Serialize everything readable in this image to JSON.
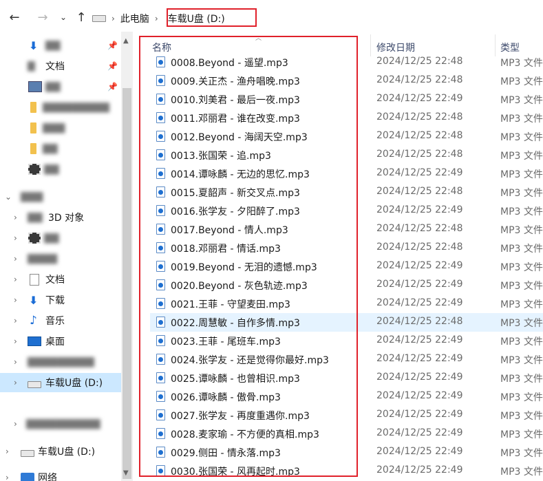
{
  "address": {
    "root_label": "此电脑",
    "current_label": "车载U盘 (D:)"
  },
  "nav_pane": {
    "items": [
      {
        "label": "",
        "icon": "download-icon",
        "pinned": true,
        "blurred": true
      },
      {
        "label": "文档",
        "icon": "document-icon",
        "pinned": true,
        "blurred": true
      },
      {
        "label": "",
        "icon": "picture-icon",
        "pinned": true,
        "blurred": true
      },
      {
        "label": "",
        "icon": "folder-icon",
        "blurred": true
      },
      {
        "label": "",
        "icon": "folder-icon",
        "blurred": true
      },
      {
        "label": "",
        "icon": "folder-icon",
        "blurred": true
      },
      {
        "label": "",
        "icon": "video-icon",
        "blurred": true
      },
      {
        "label": "",
        "icon": "pc-icon",
        "blurred": true
      },
      {
        "label": "3D 对象",
        "icon": "3d-object-icon",
        "blurred": true
      },
      {
        "label": "",
        "icon": "video-icon",
        "blurred": true
      },
      {
        "label": "",
        "icon": "picture-icon",
        "blurred": true
      },
      {
        "label": "文档",
        "icon": "document-icon"
      },
      {
        "label": "下载",
        "icon": "download-icon"
      },
      {
        "label": "音乐",
        "icon": "music-icon"
      },
      {
        "label": "桌面",
        "icon": "desktop-icon"
      },
      {
        "label": "",
        "icon": "drive-icon",
        "blurred": true
      },
      {
        "label": "车载U盘 (D:)",
        "icon": "usb-drive-icon",
        "selected": true
      },
      {
        "label": "",
        "icon": "drive-icon",
        "blurred": true
      },
      {
        "label": "车载U盘 (D:)",
        "icon": "usb-drive-icon"
      },
      {
        "label": "网络",
        "icon": "network-icon"
      }
    ]
  },
  "file_list": {
    "columns": {
      "name": "名称",
      "date": "修改日期",
      "type": "类型"
    },
    "rows": [
      {
        "name": "0008.Beyond - 遥望.mp3",
        "date": "2024/12/25 22:48",
        "type": "MP3 文件"
      },
      {
        "name": "0009.关正杰 - 渔舟唱晚.mp3",
        "date": "2024/12/25 22:48",
        "type": "MP3 文件"
      },
      {
        "name": "0010.刘美君 - 最后一夜.mp3",
        "date": "2024/12/25 22:49",
        "type": "MP3 文件"
      },
      {
        "name": "0011.邓丽君 - 谁在改变.mp3",
        "date": "2024/12/25 22:48",
        "type": "MP3 文件"
      },
      {
        "name": "0012.Beyond - 海阔天空.mp3",
        "date": "2024/12/25 22:48",
        "type": "MP3 文件"
      },
      {
        "name": "0013.张国荣 - 追.mp3",
        "date": "2024/12/25 22:48",
        "type": "MP3 文件"
      },
      {
        "name": "0014.谭咏麟 - 无边的思忆.mp3",
        "date": "2024/12/25 22:49",
        "type": "MP3 文件"
      },
      {
        "name": "0015.夏韶声 - 新交叉点.mp3",
        "date": "2024/12/25 22:48",
        "type": "MP3 文件"
      },
      {
        "name": "0016.张学友 - 夕阳醉了.mp3",
        "date": "2024/12/25 22:49",
        "type": "MP3 文件"
      },
      {
        "name": "0017.Beyond - 情人.mp3",
        "date": "2024/12/25 22:48",
        "type": "MP3 文件"
      },
      {
        "name": "0018.邓丽君 - 情话.mp3",
        "date": "2024/12/25 22:48",
        "type": "MP3 文件"
      },
      {
        "name": "0019.Beyond - 无泪的遗憾.mp3",
        "date": "2024/12/25 22:49",
        "type": "MP3 文件"
      },
      {
        "name": "0020.Beyond - 灰色轨迹.mp3",
        "date": "2024/12/25 22:49",
        "type": "MP3 文件"
      },
      {
        "name": "0021.王菲 - 守望麦田.mp3",
        "date": "2024/12/25 22:49",
        "type": "MP3 文件"
      },
      {
        "name": "0022.周慧敏 - 自作多情.mp3",
        "date": "2024/12/25 22:48",
        "type": "MP3 文件"
      },
      {
        "name": "0023.王菲 - 尾班车.mp3",
        "date": "2024/12/25 22:49",
        "type": "MP3 文件"
      },
      {
        "name": "0024.张学友 - 还是觉得你最好.mp3",
        "date": "2024/12/25 22:49",
        "type": "MP3 文件"
      },
      {
        "name": "0025.谭咏麟 - 也曾相识.mp3",
        "date": "2024/12/25 22:49",
        "type": "MP3 文件"
      },
      {
        "name": "0026.谭咏麟 - 傲骨.mp3",
        "date": "2024/12/25 22:49",
        "type": "MP3 文件"
      },
      {
        "name": "0027.张学友 - 再度重遇你.mp3",
        "date": "2024/12/25 22:49",
        "type": "MP3 文件"
      },
      {
        "name": "0028.麦家瑜 - 不方便的真相.mp3",
        "date": "2024/12/25 22:49",
        "type": "MP3 文件"
      },
      {
        "name": "0029.侧田 - 情永落.mp3",
        "date": "2024/12/25 22:49",
        "type": "MP3 文件"
      },
      {
        "name": "0030.张国荣 - 风再起时.mp3",
        "date": "2024/12/25 22:49",
        "type": "MP3 文件"
      }
    ],
    "hover_index": 14
  },
  "colors": {
    "highlight_box": "#e0202a",
    "selection": "#cce8ff",
    "hover": "#e5f3ff",
    "header_text": "#3d4a6b"
  }
}
